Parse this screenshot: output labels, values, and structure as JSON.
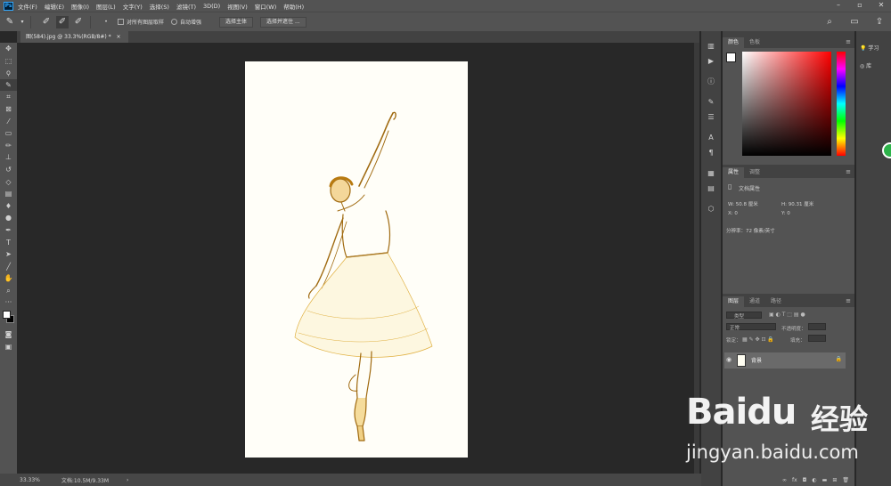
{
  "app": {
    "logo_text": "Ps"
  },
  "menu": [
    "文件(F)",
    "编辑(E)",
    "图像(I)",
    "图层(L)",
    "文字(Y)",
    "选择(S)",
    "滤镜(T)",
    "3D(D)",
    "视图(V)",
    "窗口(W)",
    "帮助(H)"
  ],
  "options_bar": {
    "sample_all_layers": "对所有图层取样",
    "auto_enhance": "自动增强",
    "select_subject": "选择主体",
    "select_and_mask": "选择并遮住 ..."
  },
  "document": {
    "tab_title": "图(584).jpg @ 33.3%(RGB/8#) *"
  },
  "status": {
    "zoom": "33.33%",
    "doc_size": "文档:10.5M/9.33M"
  },
  "color_panel": {
    "tabs": [
      "颜色",
      "色板"
    ],
    "foreground": "#ffffff",
    "background": "#000000"
  },
  "properties_panel": {
    "tabs": [
      "属性",
      "调整"
    ],
    "section": "文档属性",
    "width": "W:  50.8 厘米",
    "height": "H:  90.31 厘米",
    "x": "X:  0",
    "y": "Y:  0",
    "resolution": "分辨率：72 像素/英寸"
  },
  "layers_panel": {
    "tabs": [
      "图层",
      "通道",
      "路径"
    ],
    "kind_placeholder": "类型",
    "blend_mode": "正常",
    "opacity_label": "不透明度：",
    "lock_label": "锁定：",
    "fill_label": "填充：",
    "layer_name": "背景"
  },
  "learn_strip": {
    "learn": "学习",
    "library": "库"
  },
  "watermark": {
    "brand": "Baidu",
    "brand_cn": "经验",
    "url": "jingyan.baidu.com"
  }
}
